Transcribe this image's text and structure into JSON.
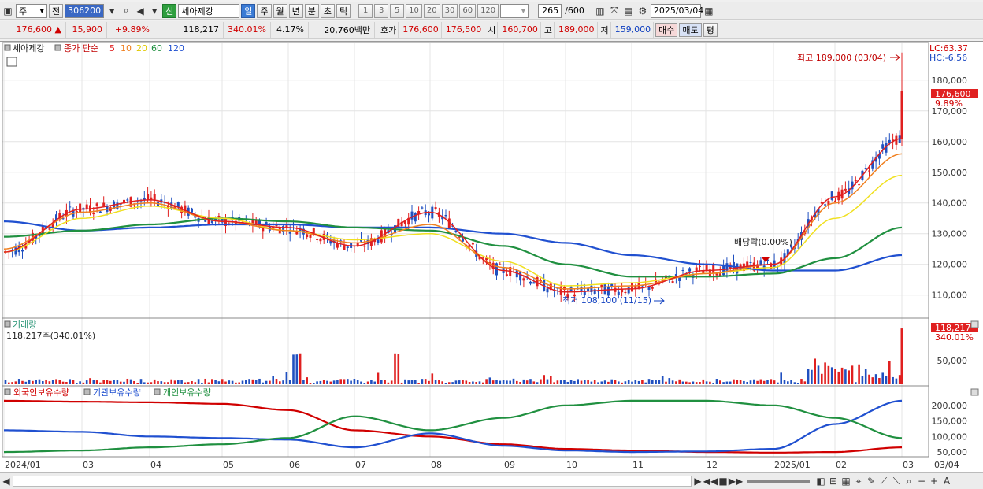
{
  "toolbar": {
    "type_label": "주",
    "prev_label": "전",
    "code": "306200",
    "badge": "신",
    "stock_name": "세아제강",
    "periods": [
      "일",
      "주",
      "월",
      "년",
      "분",
      "초",
      "틱"
    ],
    "numbers": [
      "1",
      "3",
      "5",
      "10",
      "20",
      "30",
      "60",
      "120"
    ],
    "count": "265",
    "count_total": "/600",
    "date": "2025/03/04"
  },
  "quote": {
    "price": "176,600",
    "change": "15,900",
    "change_pct": "+9.89%",
    "volume": "118,217",
    "vol_ratio": "340.01%",
    "turnover": "4.17%",
    "amount": "20,760백만",
    "bid_ask_label": "호가",
    "ask": "176,600",
    "bid": "176,500",
    "open_label": "시",
    "open": "160,700",
    "high_label": "고",
    "high": "189,000",
    "low_label": "저",
    "low": "159,000",
    "buy_label": "매수",
    "sell_label": "매도",
    "eval_label": "평"
  },
  "legend": {
    "name": "세아제강",
    "series": "종가 단순",
    "ma5": "5",
    "ma10": "10",
    "ma20": "20",
    "ma60": "60",
    "ma120": "120"
  },
  "annotations": {
    "lc": "LC:63.37",
    "hc": "HC:-6.56",
    "max": "최고 189,000 (03/04)",
    "min": "최저 108,100 (11/15)",
    "dividend": "배당락(0.00%)",
    "price_tag": "176,600",
    "pct_tag": "9.89%"
  },
  "volume_panel": {
    "title": "거래량",
    "value": "118,217주(340.01%)",
    "tag": "118,217",
    "tag_pct": "340.01%"
  },
  "holdings_panel": {
    "foreign": "외국인보유수량",
    "inst": "기관보유수량",
    "indiv": "개인보유수량"
  },
  "x_labels": [
    "2024/01",
    "03",
    "04",
    "05",
    "06",
    "07",
    "08",
    "09",
    "10",
    "11",
    "12",
    "2025/01",
    "02",
    "03"
  ],
  "x_end": "03/04",
  "colors": {
    "up": "#e02020",
    "down": "#2050c0",
    "ma5": "#e02020",
    "ma10": "#f08020",
    "ma20": "#f0e020",
    "ma60": "#209040",
    "ma120": "#2050d0"
  },
  "chart_data": [
    {
      "type": "line",
      "title": "세아제강",
      "y_ticks": [
        110000,
        120000,
        130000,
        140000,
        150000,
        160000,
        170000,
        180000
      ],
      "ylim": [
        103000,
        192000
      ],
      "x": [
        "2024/01",
        "03",
        "04",
        "05",
        "06",
        "07",
        "08",
        "09",
        "10",
        "11",
        "12",
        "2025/01",
        "02",
        "03"
      ],
      "series": [
        {
          "name": "5",
          "values": [
            124000,
            138000,
            141000,
            134000,
            132000,
            126000,
            137000,
            118000,
            111000,
            112000,
            118000,
            120000,
            142000,
            161000
          ]
        },
        {
          "name": "10",
          "values": [
            125000,
            137000,
            140000,
            134000,
            131000,
            127000,
            133000,
            119000,
            112000,
            113000,
            117000,
            120000,
            140000,
            156000
          ]
        },
        {
          "name": "20",
          "values": [
            124000,
            135000,
            139000,
            135000,
            131000,
            128000,
            130000,
            121000,
            113000,
            114000,
            117000,
            119000,
            135000,
            149000
          ]
        },
        {
          "name": "60",
          "values": [
            129000,
            131000,
            133000,
            135000,
            134000,
            132000,
            131000,
            126000,
            120000,
            116000,
            116000,
            117000,
            122000,
            132000
          ]
        },
        {
          "name": "120",
          "values": [
            134000,
            131000,
            132000,
            133000,
            133000,
            132000,
            132000,
            130000,
            127000,
            123000,
            120000,
            118000,
            118000,
            123000
          ]
        }
      ],
      "max_point": {
        "date": "03/04",
        "value": 189000
      },
      "min_point": {
        "date": "11/15",
        "value": 108100
      },
      "last_close": 176600
    },
    {
      "type": "bar",
      "title": "거래량",
      "y_ticks": [
        50000
      ],
      "last_value": 118217
    },
    {
      "type": "line",
      "title": "보유수량",
      "y_ticks": [
        50000,
        100000,
        150000,
        200000
      ],
      "x": [
        "2024/01",
        "03",
        "04",
        "05",
        "06",
        "07",
        "08",
        "09",
        "10",
        "11",
        "12",
        "2025/01",
        "02",
        "03"
      ],
      "series": [
        {
          "name": "외국인보유수량",
          "values": [
            215000,
            212000,
            210000,
            205000,
            185000,
            120000,
            100000,
            75000,
            60000,
            55000,
            50000,
            48000,
            50000,
            65000
          ]
        },
        {
          "name": "기관보유수량",
          "values": [
            120000,
            115000,
            100000,
            95000,
            90000,
            65000,
            110000,
            70000,
            55000,
            50000,
            52000,
            60000,
            140000,
            215000
          ]
        },
        {
          "name": "개인보유수량",
          "values": [
            50000,
            55000,
            65000,
            75000,
            95000,
            165000,
            120000,
            160000,
            200000,
            215000,
            215000,
            200000,
            160000,
            95000
          ]
        }
      ]
    }
  ]
}
